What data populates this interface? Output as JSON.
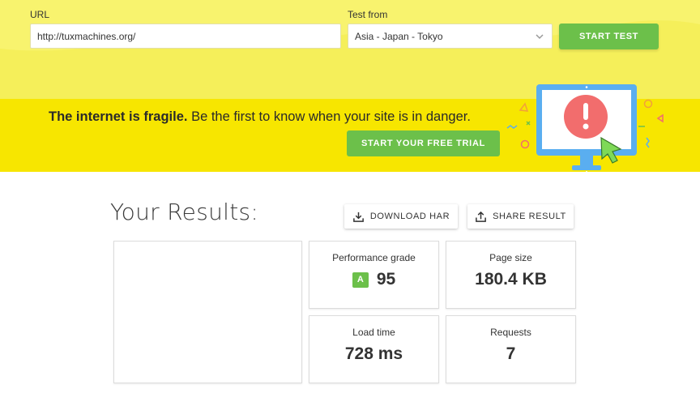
{
  "form": {
    "url_label": "URL",
    "url_value": "http://tuxmachines.org/",
    "location_label": "Test from",
    "location_value": "Asia - Japan - Tokyo",
    "start_label": "START TEST"
  },
  "promo": {
    "bold_text": "The internet is fragile.",
    "text": "Be the first to know when your site is in danger.",
    "cta_label": "START YOUR FREE TRIAL"
  },
  "results": {
    "title": "Your Results:",
    "download_har_label": "DOWNLOAD HAR",
    "share_label": "SHARE RESULT",
    "performance": {
      "label": "Performance grade",
      "grade": "A",
      "score": "95"
    },
    "page_size": {
      "label": "Page size",
      "value": "180.4 KB"
    },
    "load_time": {
      "label": "Load time",
      "value": "728 ms"
    },
    "requests": {
      "label": "Requests",
      "value": "7"
    }
  },
  "colors": {
    "top_band": "#f5ef5a",
    "promo_band": "#f7e600",
    "accent_green": "#6cc04a",
    "monitor_blue": "#5aaef0",
    "alert_red": "#f26d6d"
  },
  "icons": [
    "chevron-down-icon",
    "download-icon",
    "share-icon",
    "monitor-alert-illustration",
    "cursor-icon"
  ]
}
